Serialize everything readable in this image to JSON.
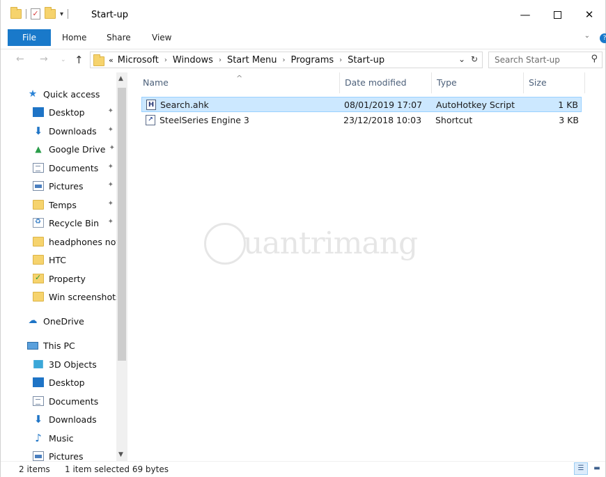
{
  "window": {
    "title": "Start-up",
    "controls": {
      "minimize": "—",
      "close": "✕"
    }
  },
  "ribbon": {
    "tabs": [
      "File",
      "Home",
      "Share",
      "View"
    ]
  },
  "address": {
    "overflow": "«",
    "crumbs": [
      "Microsoft",
      "Windows",
      "Start Menu",
      "Programs",
      "Start-up"
    ],
    "search_placeholder": "Search Start-up"
  },
  "nav": {
    "quick_access": "Quick access",
    "pinned": [
      "Desktop",
      "Downloads",
      "Google Drive",
      "Documents",
      "Pictures",
      "Temps",
      "Recycle Bin"
    ],
    "folders": [
      "headphones not",
      "HTC",
      "Property",
      "Win screenshots"
    ],
    "onedrive": "OneDrive",
    "this_pc": "This PC",
    "pc_items": [
      "3D Objects",
      "Desktop",
      "Documents",
      "Downloads",
      "Music",
      "Pictures"
    ]
  },
  "columns": [
    "Name",
    "Date modified",
    "Type",
    "Size"
  ],
  "files": [
    {
      "icon": "H",
      "name": "Search.ahk",
      "date": "08/01/2019 17:07",
      "type": "AutoHotkey Script",
      "size": "1 KB",
      "selected": true
    },
    {
      "icon": "↗",
      "name": "SteelSeries Engine 3",
      "date": "23/12/2018 10:03",
      "type": "Shortcut",
      "size": "3 KB",
      "selected": false
    }
  ],
  "status": {
    "items": "2 items",
    "selection": "1 item selected  69 bytes"
  },
  "watermark": "uantrimang",
  "colors": {
    "accent": "#1979ca",
    "selection": "#cce8ff"
  }
}
